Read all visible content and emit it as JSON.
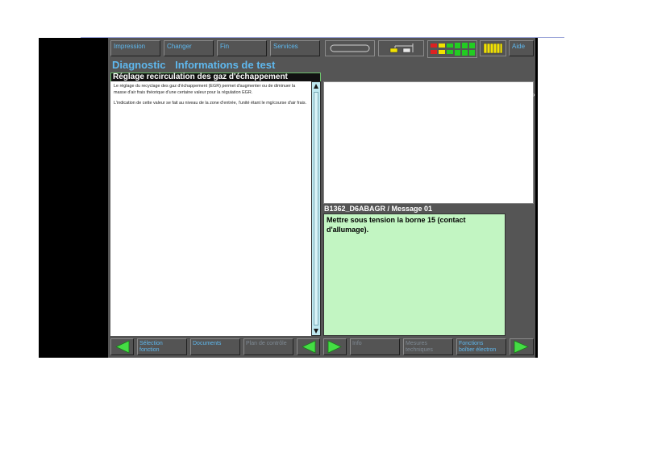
{
  "toolbar": {
    "impression": "Impression",
    "changer": "Changer",
    "fin": "Fin",
    "services": "Services",
    "aide": "Aide"
  },
  "header": {
    "module": "Diagnostic",
    "title": "Informations de test"
  },
  "left_panel": {
    "section_title": "Réglage recirculation des gaz d'échappement",
    "paragraphs": [
      "Le réglage du recyclage des gaz d'échappement (EGR) permet d'augmenter ou de diminuer la masse d'air frais théorique d'une certaine valeur pour la régulation EGR.",
      "L'indication de cette valeur se fait au niveau de la zone d'entrée, l'unité étant le mg/course d'air frais."
    ]
  },
  "message": {
    "header": "B1362_D6ABAGR / Message 01",
    "body": "Mettre sous tension la borne 15 (contact d'allumage)."
  },
  "bottom_bar": {
    "selection": [
      "Sélection",
      "fonction"
    ],
    "documents": "Documents",
    "plan": "Plan de contrôle",
    "info": "Info",
    "mesures": [
      "Mesures",
      "techniques"
    ],
    "fonctions": [
      "Fonctions",
      "boîtier électron"
    ]
  },
  "colors": {
    "accent_blue": "#5fb8ee",
    "panel_gray": "#555555",
    "message_green": "#c2f5c2",
    "status_green": "#22cc22",
    "status_yellow": "#f2e200",
    "status_red": "#dd2222"
  }
}
